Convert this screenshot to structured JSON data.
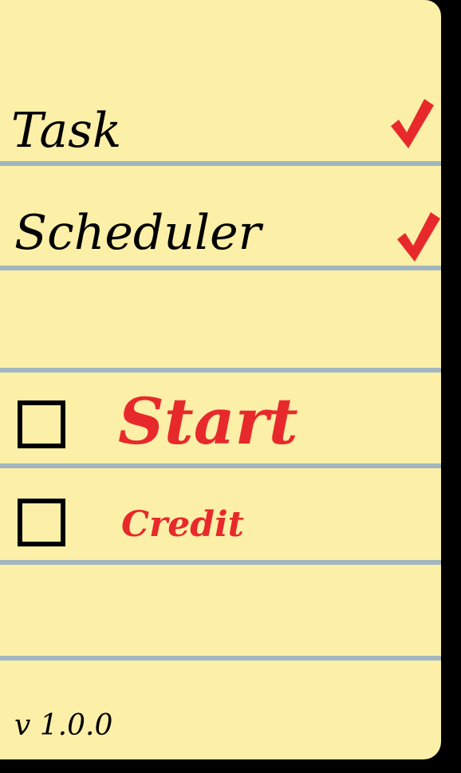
{
  "title": {
    "line1": "Task",
    "line2": "Scheduler"
  },
  "menu": {
    "items": [
      {
        "label": "Start",
        "checked": false
      },
      {
        "label": "Credit",
        "checked": false
      }
    ]
  },
  "footer": {
    "version": "v 1.0.0"
  },
  "icons": {
    "title_marks": "checkmark-icon",
    "menu_boxes": "checkbox-icon"
  },
  "colors": {
    "paper": "#FCEFA8",
    "rule_line": "#A2B6BF",
    "accent_red": "#E8292B",
    "ink": "#000000",
    "background": "#000000"
  }
}
